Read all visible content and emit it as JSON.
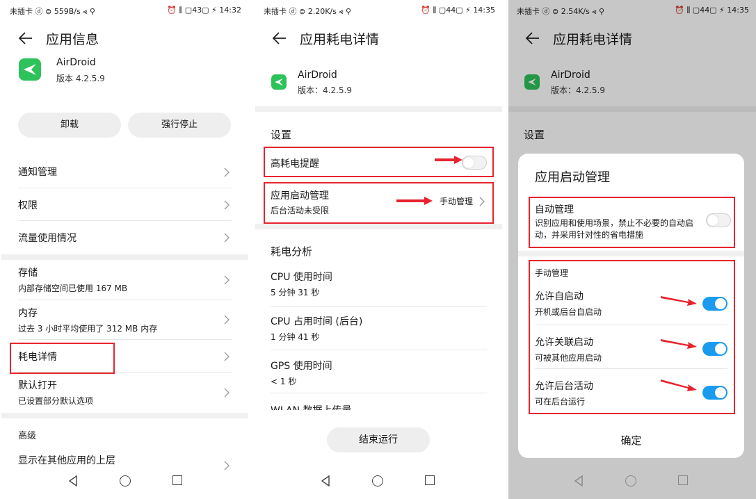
{
  "panel1": {
    "status": {
      "left": "未插卡 ⓓ ⊜ 559B/s ⪡ ⚲",
      "right": "⏰ ⫼ ▢43▢ ⚡ 14:32"
    },
    "title": "应用信息",
    "app": {
      "name": "AirDroid",
      "version": "版本 4.2.5.9"
    },
    "buttons": {
      "uninstall": "卸载",
      "force_stop": "强行停止"
    },
    "rows": [
      {
        "label": "通知管理"
      },
      {
        "label": "权限"
      },
      {
        "label": "流量使用情况"
      },
      {
        "label": "存储",
        "sub": "内部存储空间已使用 167 MB"
      },
      {
        "label": "内存",
        "sub": "过去 3 小时平均使用了 312 MB 内存"
      },
      {
        "label": "耗电详情"
      },
      {
        "label": "默认打开",
        "sub": "已设置部分默认选项"
      }
    ],
    "advanced": "高级",
    "overlay_row": "显示在其他应用的上层"
  },
  "panel2": {
    "status": {
      "left": "未插卡 ⓓ ⊜ 2.20K/s ⪡ ⚲",
      "right": "⏰ ⫼ ▢44▢ ⚡ 14:35"
    },
    "title": "应用耗电详情",
    "app": {
      "name": "AirDroid",
      "version": "版本：4.2.5.9"
    },
    "settings_title": "设置",
    "high_power_alert": "高耗电提醒",
    "launch_mgmt": {
      "label": "应用启动管理",
      "sub": "后台活动未受限",
      "value": "手动管理"
    },
    "analysis_title": "耗电分析",
    "stats": [
      {
        "label": "CPU 使用时间",
        "value": "5 分钟 31 秒"
      },
      {
        "label": "CPU 占用时间 (后台)",
        "value": "1 分钟 41 秒"
      },
      {
        "label": "GPS 使用时间",
        "value": "< 1 秒"
      },
      {
        "label": "WLAN 数据上传量",
        "value": ""
      }
    ],
    "end_button": "结束运行"
  },
  "panel3": {
    "status": {
      "left": "未插卡 ⓓ ⊜ 2.54K/s ⪡ ⚲",
      "right": "⏰ ⫼ ▢44▢ ⚡ 14:35"
    },
    "title": "应用耗电详情",
    "app": {
      "name": "AirDroid",
      "version": "版本：4.2.5.9"
    },
    "settings_title": "设置",
    "dialog": {
      "title": "应用启动管理",
      "auto": {
        "label": "自动管理",
        "sub": "识别应用和使用场景，禁止不必要的自动启动，并采用针对性的省电措施",
        "on": false
      },
      "manual_title": "手动管理",
      "items": [
        {
          "label": "允许自启动",
          "sub": "开机或后台自启动",
          "on": true
        },
        {
          "label": "允许关联启动",
          "sub": "可被其他应用启动",
          "on": true
        },
        {
          "label": "允许后台活动",
          "sub": "可在后台运行",
          "on": true
        }
      ],
      "confirm": "确定"
    }
  },
  "colors": {
    "highlight": "#e8232e",
    "toggle_on": "#1a9bf0",
    "app_icon": "#2ec25a"
  },
  "icons": [
    "back-arrow-icon",
    "chevron-right-icon",
    "airdroid-logo-icon",
    "nav-back-icon",
    "nav-home-icon",
    "nav-recent-icon"
  ]
}
